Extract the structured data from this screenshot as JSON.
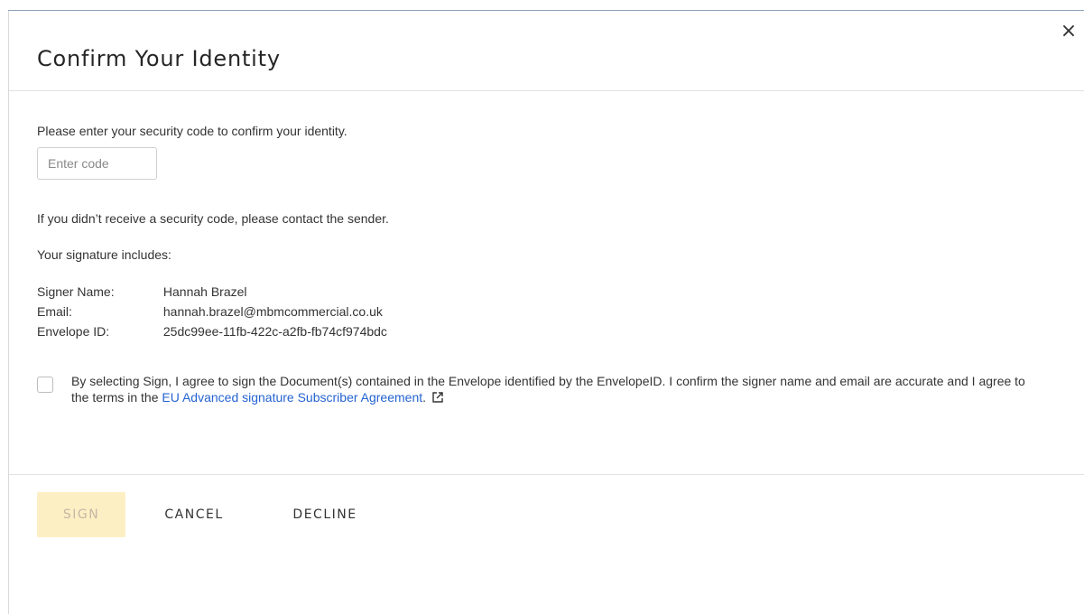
{
  "dialog": {
    "title": "Confirm Your Identity",
    "close_label": "×",
    "intro_text": "Please enter your security code to confirm your identity.",
    "code_input": {
      "value": "",
      "placeholder": "Enter code"
    },
    "no_code_text": "If you didn’t receive a security code, please contact the sender.",
    "includes_text": "Your signature includes:",
    "signer": {
      "name_label": "Signer Name:",
      "name_value": "Hannah Brazel",
      "email_label": "Email:",
      "email_value": "hannah.brazel@mbmcommercial.co.uk",
      "envelope_label": "Envelope ID:",
      "envelope_value": "25dc99ee-11fb-422c-a2fb-fb74cf974bdc"
    },
    "agreement": {
      "checked": false,
      "text_before_link": "By selecting Sign, I agree to sign the Document(s) contained in the Envelope identified by the EnvelopeID. I confirm the signer name and email are accurate and I agree to the terms in the ",
      "link_text": "EU Advanced signature Subscriber Agreement",
      "text_after_link": ".",
      "link_icon": "external-link-icon"
    },
    "buttons": {
      "sign": "SIGN",
      "cancel": "CANCEL",
      "decline": "DECLINE"
    },
    "colors": {
      "link": "#2463d1",
      "sign_disabled_bg": "#fdefc4",
      "sign_disabled_text": "#c2b8a3"
    }
  }
}
